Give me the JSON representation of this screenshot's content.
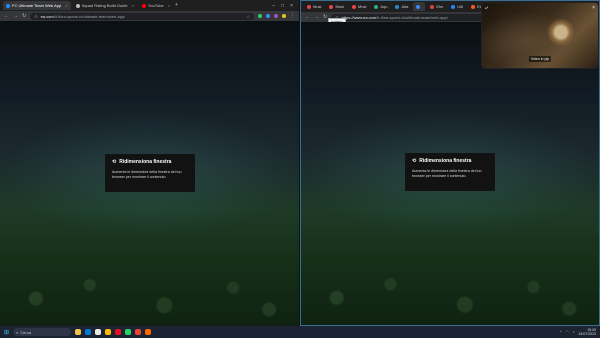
{
  "left_window": {
    "tabs": [
      {
        "label": "FC Ultimate Team Web App",
        "favicon_color": "#1f8bff",
        "active": true
      },
      {
        "label": "Squad Rating Build Guide",
        "favicon_color": "#bbbbbb",
        "active": false
      },
      {
        "label": "YouTube",
        "favicon_color": "#ff0000",
        "active": false
      }
    ],
    "url_host": "ea.com",
    "url_path": "/it-it/ea-sports-fc/ultimate-team/web-app/",
    "dialog": {
      "title": "Ridimensiona finestra",
      "body": "Aumenta le dimensioni della finestra del tuo browser per mostrare il contenuto."
    }
  },
  "right_window": {
    "tabs": [
      {
        "label": "Musi",
        "favicon_color": "#e44",
        "active": false
      },
      {
        "label": "Musi",
        "favicon_color": "#e44",
        "active": false
      },
      {
        "label": "Musi",
        "favicon_color": "#e44",
        "active": false
      },
      {
        "label": "Aqu",
        "favicon_color": "#3a8",
        "active": false
      },
      {
        "label": "Atla",
        "favicon_color": "#38c",
        "active": false
      },
      {
        "label": "",
        "favicon_color": "#4285f4",
        "active": true
      },
      {
        "label": "Elm",
        "favicon_color": "#d44",
        "active": false
      },
      {
        "label": "Ulti",
        "favicon_color": "#1f8bff",
        "active": false
      },
      {
        "label": "EA",
        "favicon_color": "#ff5a1f",
        "active": false
      }
    ],
    "url_host": "https://www.ea.com",
    "url_path": "/it-it/ea-sports-fc/ultimate-team/web-app/",
    "tooltip": "Indietro",
    "dialog": {
      "title": "Ridimensiona finestra",
      "body": "Aumenta le dimensioni della finestra del tuo browser per mostrare il contenuto."
    }
  },
  "pip": {
    "caption": "Video in pip",
    "back_icon": "back-to-tab-icon",
    "close_icon": "close-icon"
  },
  "taskbar": {
    "search_placeholder": "Cerca",
    "apps": [
      "#f2c14e",
      "#0078d4",
      "#e9e9e9",
      "#ffb900",
      "#e81123",
      "#25d366",
      "#ea4335",
      "#ff6a00"
    ],
    "time": "15:09",
    "date": "24/07/2023"
  }
}
